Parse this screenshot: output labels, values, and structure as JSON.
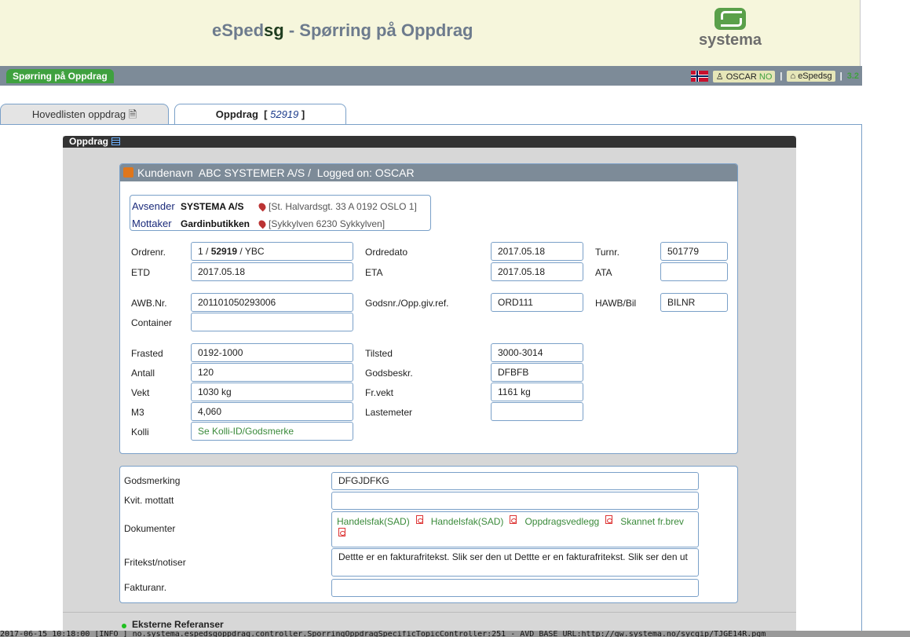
{
  "header": {
    "title_pre": "eSped",
    "title_sg": "sg",
    "title_post": " - Spørring på Oppdrag",
    "logo_text": "systema"
  },
  "navbar": {
    "tab_label": "Spørring på Oppdrag",
    "user": "OSCAR",
    "lang": "NO",
    "app": "eSpedsg",
    "version": "3.2"
  },
  "tabs": {
    "list_label": "Hovedlisten oppdrag",
    "current_label": "Oppdrag",
    "current_num": "52919"
  },
  "panel": {
    "title": "Oppdrag"
  },
  "customer": {
    "kunde_label": "Kundenavn",
    "kunde": "ABC SYSTEMER A/S",
    "slash": "/",
    "logged_label": "Logged on:",
    "logged": "OSCAR"
  },
  "avsender": {
    "label": "Avsender",
    "name": "SYSTEMA A/S",
    "addr": "[St. Halvardsgt. 33 A    0192 OSLO 1]"
  },
  "mottaker": {
    "label": "Mottaker",
    "name": "Gardinbutikken",
    "addr": "[Sykkylven    6230 Sykkylven]"
  },
  "fields": {
    "ordrenr_label": "Ordrenr.",
    "ordrenr_a": "1",
    "ordrenr_b": "52919",
    "ordrenr_c": "YBC",
    "ordredato_label": "Ordredato",
    "ordredato": "2017.05.18",
    "turnr_label": "Turnr.",
    "turnr": "501779",
    "etd_label": "ETD",
    "etd": "2017.05.18",
    "eta_label": "ETA",
    "eta": "2017.05.18",
    "ata_label": "ATA",
    "ata": "",
    "awb_label": "AWB.Nr.",
    "awb": "201101050293006",
    "godsnr_label": "Godsnr./Opp.giv.ref.",
    "godsnr": "ORD111",
    "hawb_label": "HAWB/Bil",
    "hawb": "BILNR",
    "container_label": "Container",
    "container": "",
    "frasted_label": "Frasted",
    "frasted": "0192-1000",
    "tilsted_label": "Tilsted",
    "tilsted": "3000-3014",
    "antall_label": "Antall",
    "antall": "120",
    "godsbeskr_label": "Godsbeskr.",
    "godsbeskr": "DFBFB",
    "vekt_label": "Vekt",
    "vekt": "1030 kg",
    "frvekt_label": "Fr.vekt",
    "frvekt": "1161 kg",
    "m3_label": "M3",
    "m3": "4,060",
    "lastemeter_label": "Lastemeter",
    "lastemeter": "",
    "kolli_label": "Kolli",
    "kolli": "Se Kolli-ID/Godsmerke"
  },
  "details": {
    "godsmerking_label": "Godsmerking",
    "godsmerking": "DFGJDFKG",
    "kvit_label": "Kvit. mottatt",
    "kvit": "",
    "dok_label": "Dokumenter",
    "docs": [
      "Handelsfak(SAD)",
      "Handelsfak(SAD)",
      "Oppdragsvedlegg",
      "Skannet fr.brev"
    ],
    "fritekst_label": "Fritekst/notiser",
    "fritekst": "Dettte er en fakturafritekst. Slik ser den ut Dettte er en fakturafritekst. Slik ser den ut",
    "fakturanr_label": "Fakturanr.",
    "fakturanr": ""
  },
  "ext": {
    "label": "Eksterne Referanser"
  },
  "log": "2017-06-15 10:18:00 [INFO ] no.systema.espedsgoppdrag.controller.SporringOppdragSpecificTopicController:251 - AVD_BASE_URL:http://gw.systema.no/sycgip/TJGE14R.pgm"
}
